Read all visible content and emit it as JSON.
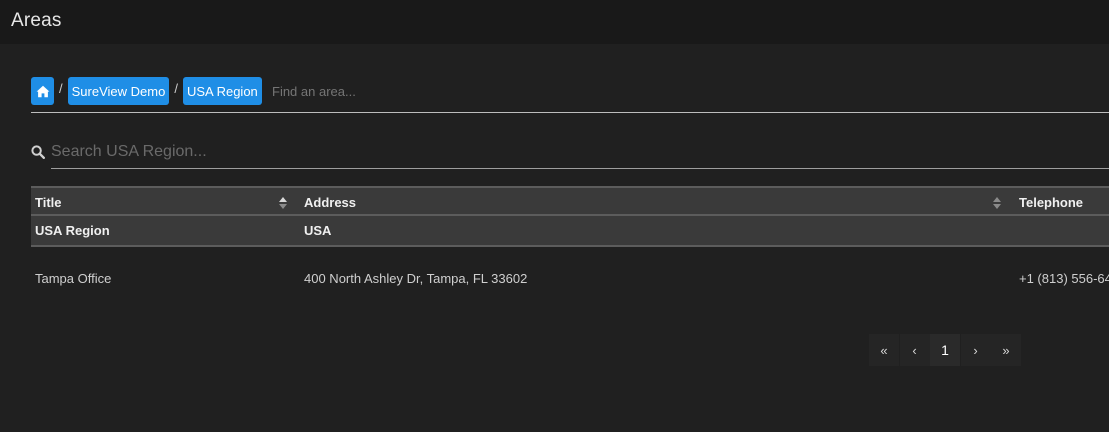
{
  "header": {
    "title": "Areas"
  },
  "breadcrumb": {
    "home_icon": "home-icon",
    "separator": "/",
    "items": [
      {
        "label": "SureView Demo"
      },
      {
        "label": "USA Region"
      }
    ],
    "find_placeholder": "Find an area..."
  },
  "search": {
    "icon": "search-icon",
    "placeholder": "Search USA Region..."
  },
  "table": {
    "columns": [
      {
        "label": "Title",
        "sortable": true
      },
      {
        "label": "Address",
        "sortable": true
      },
      {
        "label": "Telephone",
        "sortable": false
      }
    ],
    "group_row": {
      "title": "USA Region",
      "address": "USA",
      "telephone": ""
    },
    "rows": [
      {
        "title": "Tampa Office",
        "address": "400 North Ashley Dr, Tampa, FL 33602",
        "telephone": "+1 (813) 556-64"
      }
    ]
  },
  "pagination": {
    "first": "«",
    "prev": "‹",
    "current": "1",
    "next": "›",
    "last": "»"
  },
  "colors": {
    "accent": "#1f8ee6",
    "background": "#202020",
    "header_bg": "#191919",
    "table_header_bg": "#3a3a3a"
  }
}
